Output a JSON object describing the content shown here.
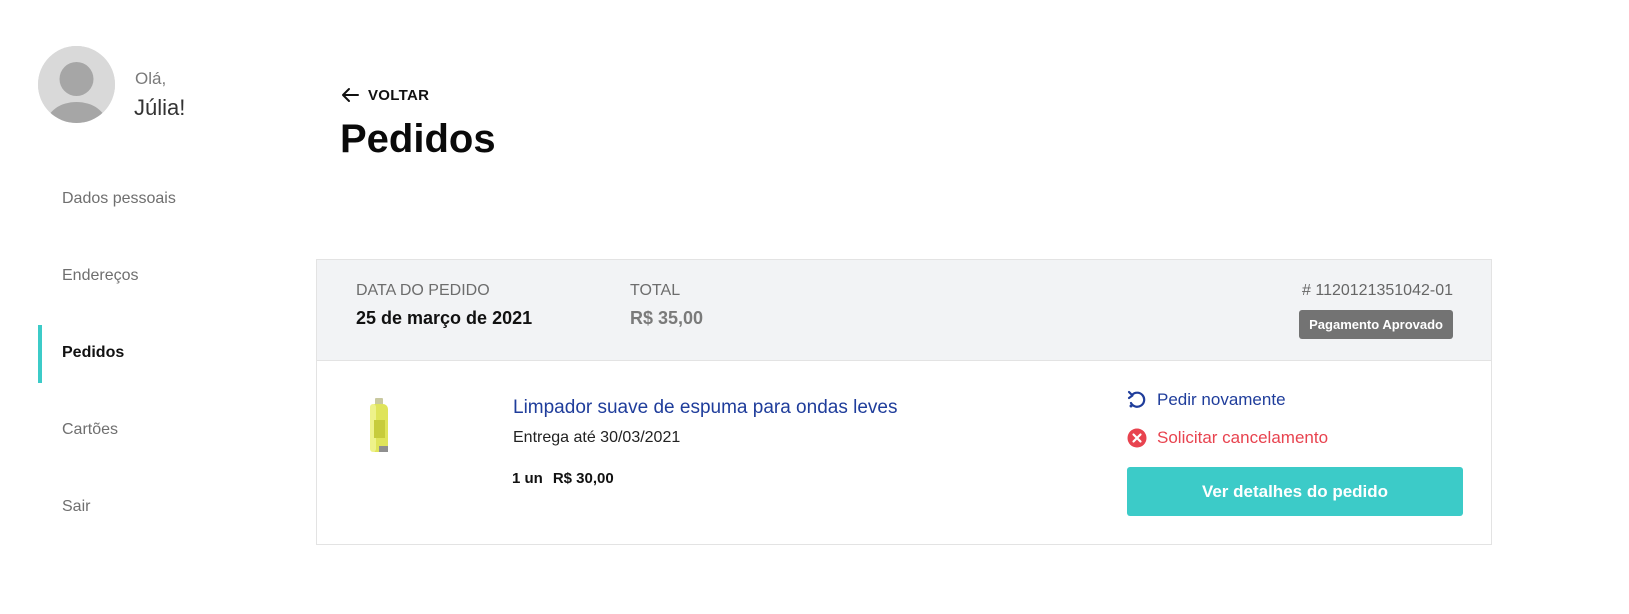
{
  "user": {
    "greeting": "Olá,",
    "name": "Júlia!"
  },
  "sidebar": {
    "items": [
      {
        "label": "Dados pessoais",
        "active": false
      },
      {
        "label": "Endereços",
        "active": false
      },
      {
        "label": "Pedidos",
        "active": true
      },
      {
        "label": "Cartões",
        "active": false
      },
      {
        "label": "Sair",
        "active": false
      }
    ]
  },
  "main": {
    "back_label": "VOLTAR",
    "title": "Pedidos"
  },
  "order": {
    "date_label": "DATA DO PEDIDO",
    "date_value": "25 de março de 2021",
    "total_label": "TOTAL",
    "total_value": "R$ 35,00",
    "order_id": "# 1120121351042-01",
    "status": "Pagamento Aprovado",
    "product": {
      "name": "Limpador suave de espuma para ondas leves",
      "delivery": "Entrega até 30/03/2021",
      "quantity": "1 un",
      "price": "R$ 30,00"
    },
    "actions": {
      "reorder": "Pedir novamente",
      "cancel": "Solicitar cancelamento",
      "details": "Ver detalhes do pedido"
    }
  },
  "colors": {
    "accent": "#3ccbc8",
    "link": "#1f3d9b",
    "danger": "#e8434f",
    "badge": "#737373"
  }
}
